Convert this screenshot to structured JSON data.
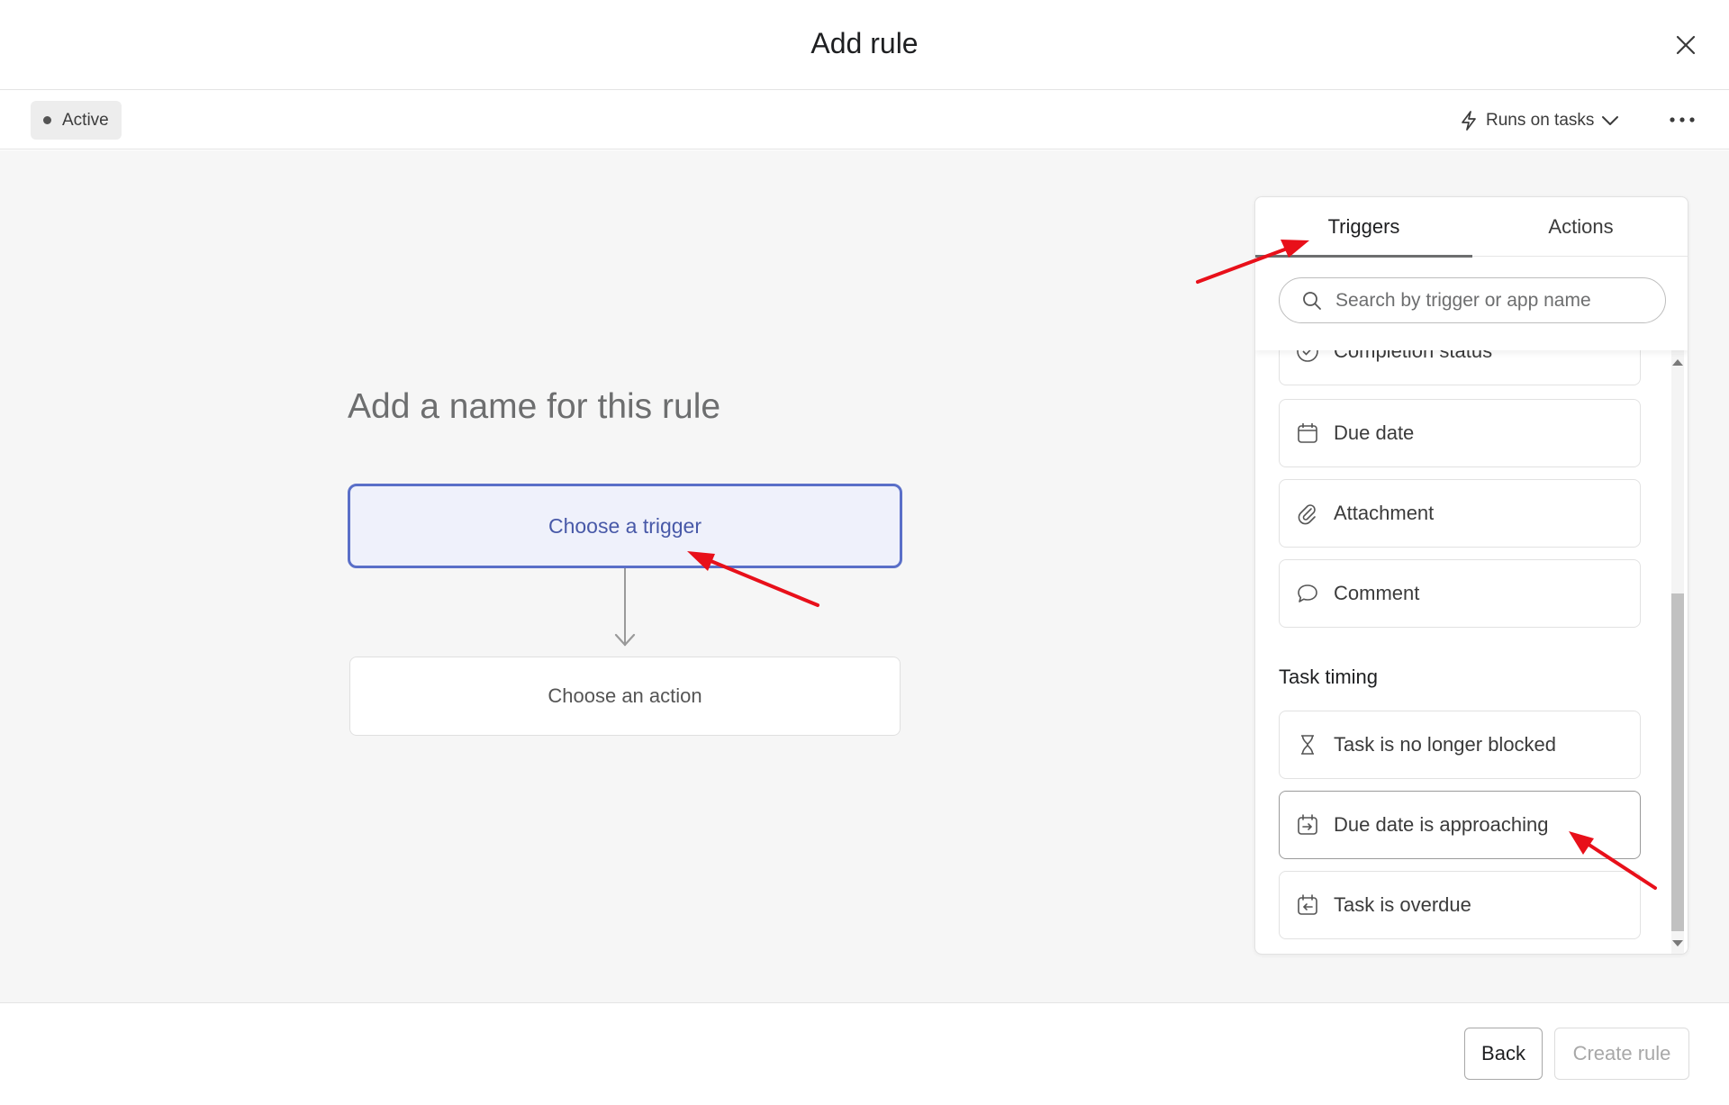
{
  "header": {
    "title": "Add rule"
  },
  "toolbar": {
    "status": "Active",
    "runs_on": "Runs on tasks"
  },
  "canvas": {
    "rule_name_placeholder": "Add a name for this rule",
    "trigger_label": "Choose a trigger",
    "action_label": "Choose an action"
  },
  "panel": {
    "tabs": [
      {
        "label": "Triggers",
        "active": true
      },
      {
        "label": "Actions",
        "active": false
      }
    ],
    "search_placeholder": "Search by trigger or app name",
    "items": [
      {
        "label": "Completion status",
        "icon": "check-circle-icon"
      },
      {
        "label": "Due date",
        "icon": "calendar-icon"
      },
      {
        "label": "Attachment",
        "icon": "paperclip-icon"
      },
      {
        "label": "Comment",
        "icon": "speech-bubble-icon"
      }
    ],
    "section_task_timing": "Task timing",
    "timing_items": [
      {
        "label": "Task is no longer blocked",
        "icon": "hourglass-icon"
      },
      {
        "label": "Due date is approaching",
        "icon": "calendar-arrow-in-icon"
      },
      {
        "label": "Task is overdue",
        "icon": "calendar-arrow-back-icon"
      }
    ]
  },
  "footer": {
    "back_label": "Back",
    "create_label": "Create rule"
  },
  "colors": {
    "trigger_border": "#5a6fc8",
    "trigger_fill": "#eff1fb",
    "annotation_arrow": "#e8101a"
  }
}
